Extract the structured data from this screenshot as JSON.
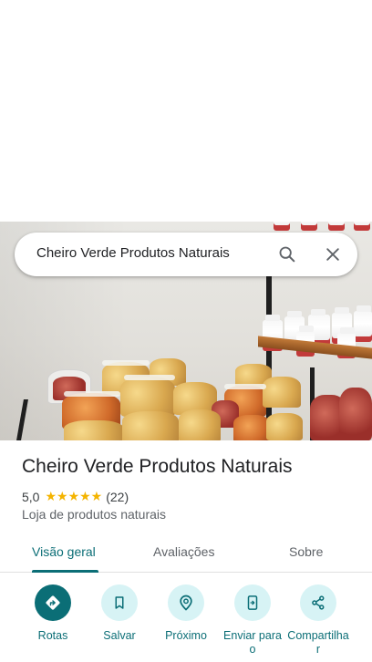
{
  "search": {
    "query": "Cheiro Verde Produtos Naturais",
    "search_icon": "search-icon",
    "close_icon": "close-icon"
  },
  "place": {
    "name": "Cheiro Verde Produtos Naturais",
    "rating": "5,0",
    "stars": "★★★★★",
    "review_count": "(22)",
    "category": "Loja de produtos naturais"
  },
  "tabs": [
    {
      "label": "Visão geral",
      "active": true
    },
    {
      "label": "Avaliações",
      "active": false
    },
    {
      "label": "Sobre",
      "active": false
    }
  ],
  "actions": [
    {
      "label": "Rotas",
      "icon": "directions-icon"
    },
    {
      "label": "Salvar",
      "icon": "bookmark-icon"
    },
    {
      "label": "Próximo",
      "icon": "nearby-icon"
    },
    {
      "label": "Enviar para o",
      "icon": "send-to-phone-icon"
    },
    {
      "label": "Compartilhar",
      "icon": "share-icon"
    }
  ],
  "colors": {
    "accent": "#0b6e76",
    "accent_light": "#d7f3f5",
    "star": "#f4b400"
  }
}
